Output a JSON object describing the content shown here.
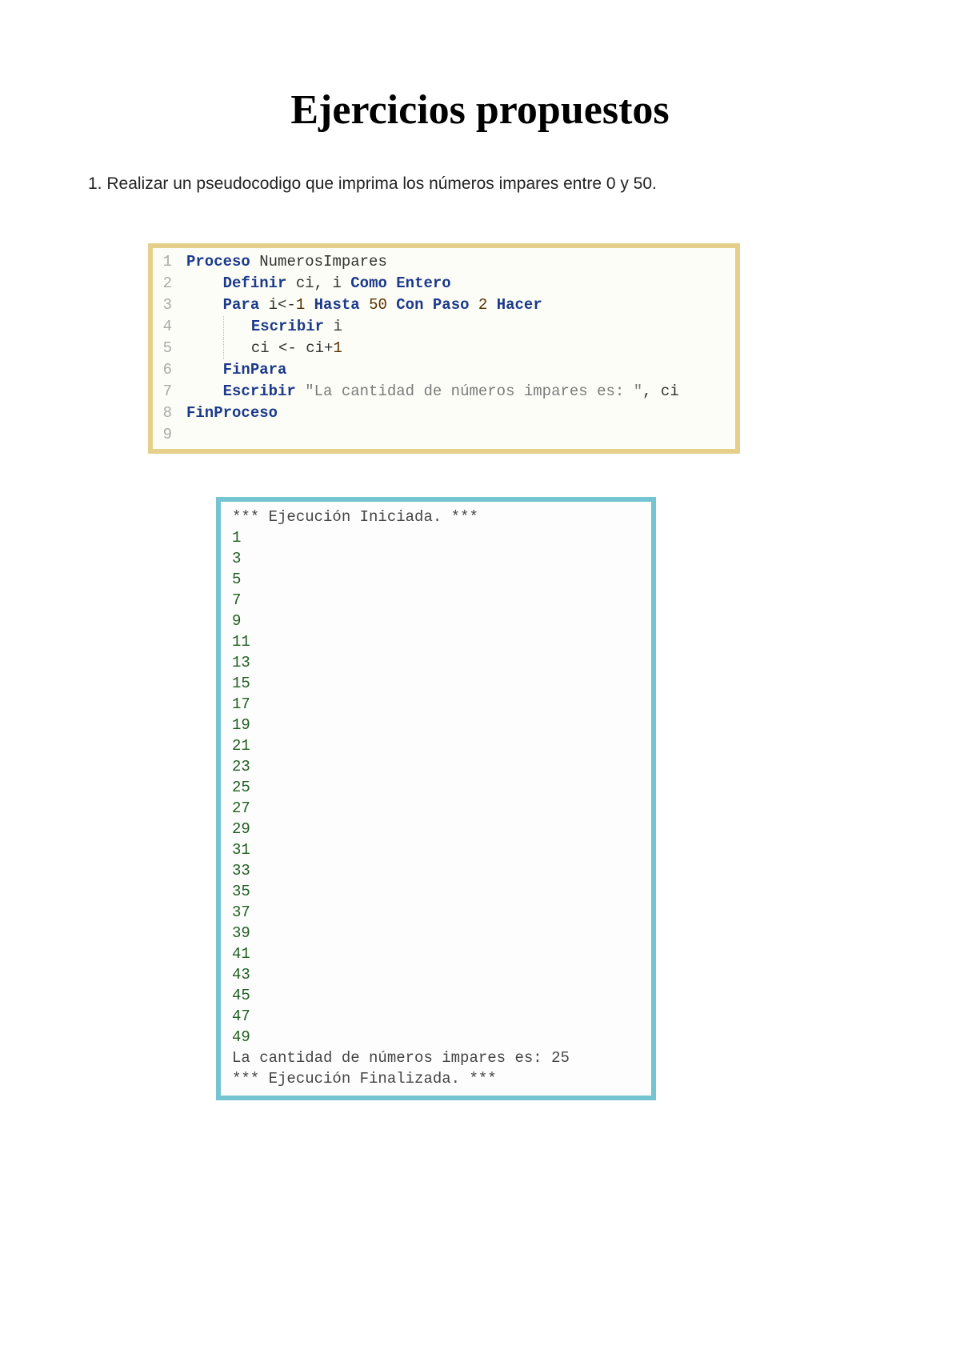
{
  "title": "Ejercicios propuestos",
  "prompt": "1. Realizar un pseudocodigo que imprima los números impares entre 0 y 50.",
  "code": {
    "line_numbers": [
      "1",
      "2",
      "3",
      "4",
      "5",
      "6",
      "7",
      "8",
      "9"
    ],
    "raw_source": "Proceso NumerosImpares\n    Definir ci, i Como Entero\n    Para i<-1 Hasta 50 Con Paso 2 Hacer\n        Escribir i\n        ci <- ci+1\n    FinPara\n    Escribir \"La cantidad de números impares es: \", ci\nFinProceso\n",
    "tokens": [
      [
        {
          "t": "Proceso",
          "c": "kw"
        },
        {
          "t": " "
        },
        {
          "t": "NumerosImpares",
          "c": "id"
        }
      ],
      [
        {
          "t": "    "
        },
        {
          "t": "Definir",
          "c": "kw"
        },
        {
          "t": " ci, i "
        },
        {
          "t": "Como",
          "c": "kw"
        },
        {
          "t": " "
        },
        {
          "t": "Entero",
          "c": "kw"
        }
      ],
      [
        {
          "t": "    "
        },
        {
          "t": "Para",
          "c": "kw"
        },
        {
          "t": " i<-"
        },
        {
          "t": "1",
          "c": "num"
        },
        {
          "t": " "
        },
        {
          "t": "Hasta",
          "c": "kw"
        },
        {
          "t": " "
        },
        {
          "t": "50",
          "c": "num"
        },
        {
          "t": " "
        },
        {
          "t": "Con Paso",
          "c": "kw"
        },
        {
          "t": " "
        },
        {
          "t": "2",
          "c": "num"
        },
        {
          "t": " "
        },
        {
          "t": "Hacer",
          "c": "kw"
        }
      ],
      [
        {
          "t": "    "
        },
        {
          "guide": true
        },
        {
          "t": "   "
        },
        {
          "t": "Escribir",
          "c": "kw"
        },
        {
          "t": " i"
        }
      ],
      [
        {
          "t": "    "
        },
        {
          "guide": true
        },
        {
          "t": "   ci <- ci+"
        },
        {
          "t": "1",
          "c": "num"
        }
      ],
      [
        {
          "t": "    "
        },
        {
          "t": "FinPara",
          "c": "kw"
        }
      ],
      [
        {
          "t": "    "
        },
        {
          "t": "Escribir",
          "c": "kw"
        },
        {
          "t": " "
        },
        {
          "t": "\"La cantidad de números impares es: \"",
          "c": "str"
        },
        {
          "t": ", ci"
        }
      ],
      [
        {
          "t": "FinProceso",
          "c": "kw"
        }
      ],
      [
        {
          "t": ""
        }
      ]
    ]
  },
  "output": {
    "start_banner": "*** Ejecución Iniciada. ***",
    "numbers": [
      "1",
      "3",
      "5",
      "7",
      "9",
      "11",
      "13",
      "15",
      "17",
      "19",
      "21",
      "23",
      "25",
      "27",
      "29",
      "31",
      "33",
      "35",
      "37",
      "39",
      "41",
      "43",
      "45",
      "47",
      "49"
    ],
    "summary": "La cantidad de números impares es: 25",
    "end_banner": "*** Ejecución Finalizada. ***"
  }
}
